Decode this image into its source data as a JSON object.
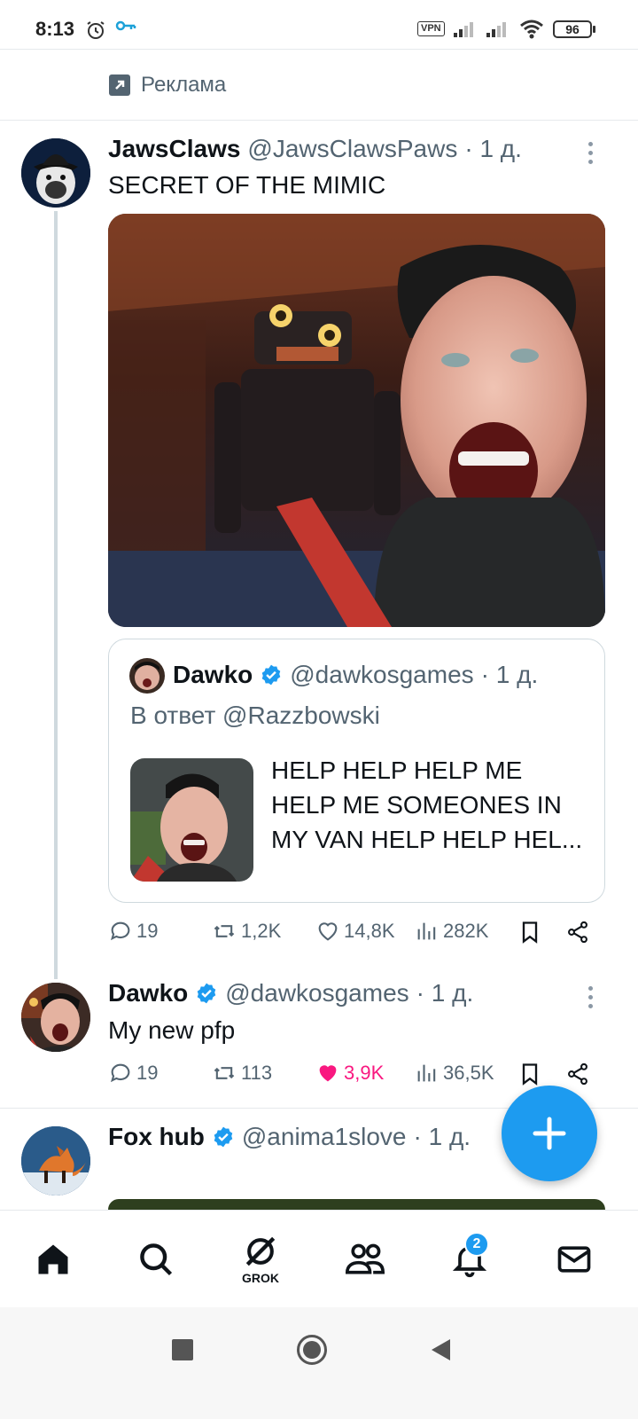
{
  "status_bar": {
    "time": "8:13",
    "vpn": "VPN",
    "battery": "96"
  },
  "ad": {
    "label": "Реклама"
  },
  "post1": {
    "name": "JawsClaws",
    "handle": "@JawsClawsPaws",
    "time": "· 1 д.",
    "text": "SECRET OF THE MIMIC",
    "quote": {
      "name": "Dawko",
      "handle": "@dawkosgames",
      "time": "· 1 д.",
      "reply_to": "В ответ @Razzbowski",
      "text": "HELP HELP HELP ME HELP ME SOMEONES IN MY VAN HELP HELP HEL..."
    },
    "actions": {
      "replies": "19",
      "reposts": "1,2K",
      "likes": "14,8K",
      "views": "282K"
    }
  },
  "post2": {
    "name": "Dawko",
    "handle": "@dawkosgames",
    "time": "· 1 д.",
    "text": "My new pfp",
    "actions": {
      "replies": "19",
      "reposts": "113",
      "likes": "3,9K",
      "views": "36,5K"
    }
  },
  "post3": {
    "name": "Fox hub",
    "handle": "@anima1slove",
    "time": "· 1 д."
  },
  "bottom_nav": {
    "grok_label": "GROK",
    "notification_count": "2"
  },
  "colors": {
    "accent": "#1d9bf0",
    "like": "#f91880",
    "secondary_text": "#536471"
  }
}
